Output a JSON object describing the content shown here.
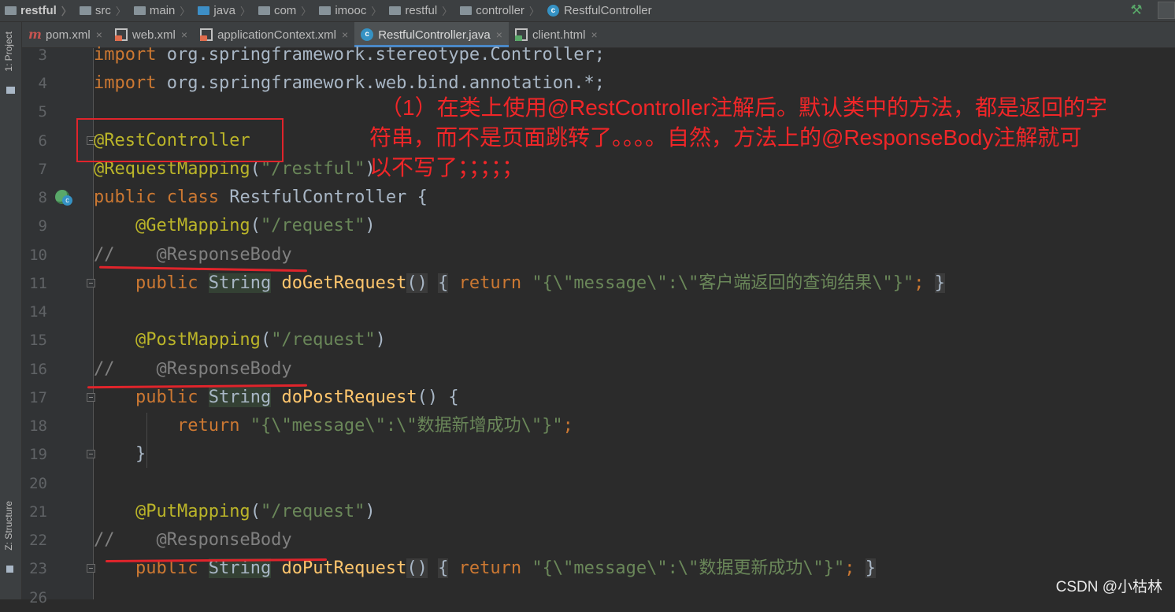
{
  "breadcrumbs": [
    "restful",
    "src",
    "main",
    "java",
    "com",
    "imooc",
    "restful",
    "controller",
    "RestfulController"
  ],
  "tabs": [
    {
      "label": "pom.xml",
      "icon": "maven-icon"
    },
    {
      "label": "web.xml",
      "icon": "xml-file-icon"
    },
    {
      "label": "applicationContext.xml",
      "icon": "xml-file-icon"
    },
    {
      "label": "RestfulController.java",
      "icon": "java-class-icon",
      "active": true
    },
    {
      "label": "client.html",
      "icon": "html-file-icon"
    }
  ],
  "tool_windows": {
    "project": "1: Project",
    "structure": "Z: Structure"
  },
  "lines": {
    "l3": {
      "num": "3",
      "kw": "import",
      "rest": " org.springframework.stereotype.Controller;"
    },
    "l4": {
      "num": "4",
      "kw": "import",
      "rest": " org.springframework.web.bind.annotation.*;"
    },
    "l5": {
      "num": "5"
    },
    "l6": {
      "num": "6",
      "ann": "@RestController"
    },
    "l7": {
      "num": "7",
      "ann": "@RequestMapping",
      "open": "(",
      "str": "\"/restful\"",
      "close": ")"
    },
    "l8": {
      "num": "8",
      "kw": "public class",
      "rest": " RestfulController {"
    },
    "l9": {
      "num": "9",
      "indent": "    ",
      "ann": "@GetMapping",
      "open": "(",
      "str": "\"/request\"",
      "close": ")"
    },
    "l10": {
      "num": "10",
      "cmt": "//    @ResponseBody"
    },
    "l11": {
      "num": "11",
      "indent": "    ",
      "kw": "public",
      "type": "String",
      "fn": "doGetRequest",
      "parens": "()",
      "ob": "{",
      "ret": "return",
      "str": "\"{\\\"message\\\":\\\"客户端返回的查询结果\\\"}\"",
      "semi": ";",
      "cb": "}"
    },
    "l14": {
      "num": "14"
    },
    "l15": {
      "num": "15",
      "indent": "    ",
      "ann": "@PostMapping",
      "open": "(",
      "str": "\"/request\"",
      "close": ")"
    },
    "l16": {
      "num": "16",
      "cmt": "//    @ResponseBody"
    },
    "l17": {
      "num": "17",
      "indent": "    ",
      "kw": "public",
      "type": "String",
      "fn": "doPostRequest",
      "tail": "() {"
    },
    "l18": {
      "num": "18",
      "indent": "        ",
      "ret": "return",
      "str": "\"{\\\"message\\\":\\\"数据新增成功\\\"}\"",
      "semi": ";"
    },
    "l19": {
      "num": "19",
      "indent": "    ",
      "brace": "}"
    },
    "l20": {
      "num": "20"
    },
    "l21": {
      "num": "21",
      "indent": "    ",
      "ann": "@PutMapping",
      "open": "(",
      "str": "\"/request\"",
      "close": ")"
    },
    "l22": {
      "num": "22",
      "cmt": "//    @ResponseBody"
    },
    "l23": {
      "num": "23",
      "indent": "    ",
      "kw": "public",
      "type": "String",
      "fn": "doPutRequest",
      "parens": "()",
      "ob": "{",
      "ret": "return",
      "str": "\"{\\\"message\\\":\\\"数据更新成功\\\"}\"",
      "semi": ";",
      "cb": "}"
    },
    "l26": {
      "num": "26"
    }
  },
  "annotation_note": {
    "line1": "（1）在类上使用@RestController注解后。默认类中的方法，都是返回的字",
    "line2": "符串，而不是页面跳转了。。。。自然，方法上的@ResponseBody注解就可",
    "line3": "以不写了；；；；；"
  },
  "watermark": "CSDN @小枯林",
  "colors": {
    "annotation_red": "#f02628",
    "keyword": "#cc7832",
    "annotation": "#bbb529",
    "string": "#6a8759",
    "comment": "#808080",
    "method": "#ffc66d",
    "active_tab_underline": "#4a88c7"
  }
}
